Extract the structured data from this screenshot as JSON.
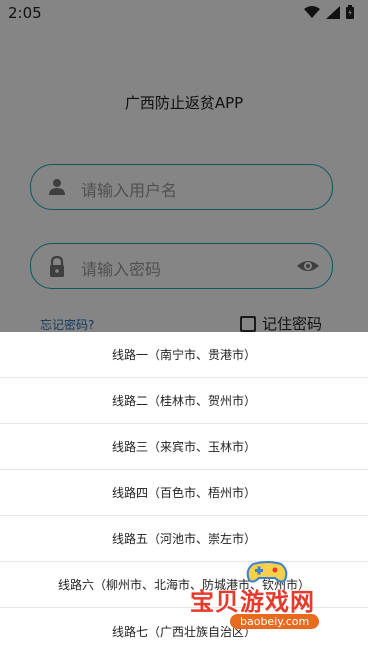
{
  "status_bar": {
    "time": "2:05"
  },
  "app": {
    "title": "广西防止返贫APP"
  },
  "login": {
    "username_placeholder": "请输入用户名",
    "password_placeholder": "请输入密码",
    "forgot_password": "忘记密码?",
    "remember_password": "记住密码"
  },
  "sheet": {
    "options": [
      "线路一（南宁市、贵港市）",
      "线路二（桂林市、贺州市）",
      "线路三（来宾市、玉林市）",
      "线路四（百色市、梧州市）",
      "线路五（河池市、崇左市）",
      "线路六（柳州市、北海市、防城港市、钦州市）",
      "线路七（广西壮族自治区）"
    ]
  },
  "watermark": {
    "name": "宝贝游戏网",
    "url": "baobeiy.com"
  },
  "colors": {
    "accent": "#19a7b7",
    "link": "#1f6fb6",
    "overlay": "rgba(0,0,0,0.48)",
    "watermark": "#e53a2c"
  }
}
